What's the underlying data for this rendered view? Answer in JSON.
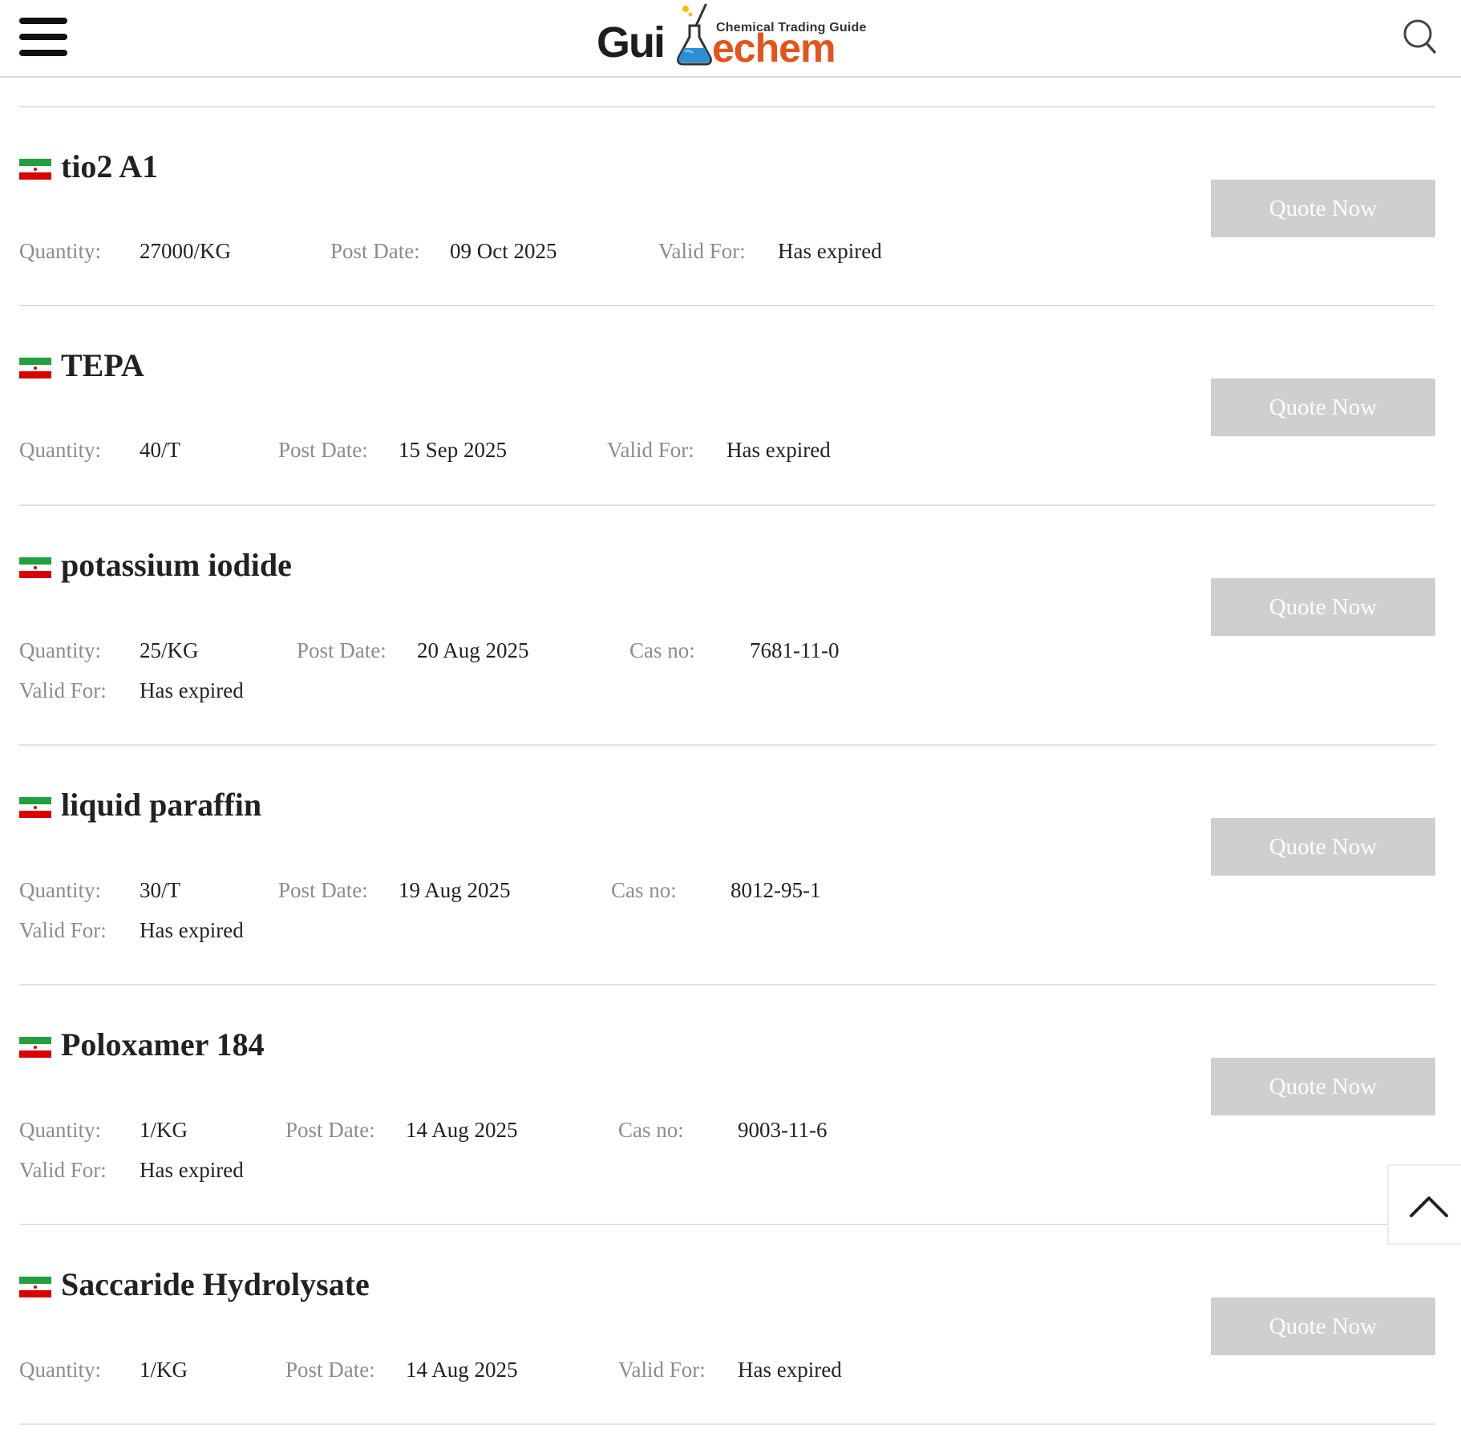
{
  "header": {
    "menu_icon": "hamburger-menu-icon",
    "search_icon": "search-icon",
    "logo": {
      "tagline": "Chemical Trading Guide",
      "word_left": "Gui",
      "word_right": "echem",
      "brand_color": "#e5531b"
    }
  },
  "labels": {
    "quantity": "Quantity:",
    "post_date": "Post Date:",
    "valid_for": "Valid For:",
    "cas_no": "Cas no:"
  },
  "quote_label": "Quote Now",
  "colors": {
    "quote_button_bg": "#cfcfcf",
    "label_text": "#8c8c8c",
    "divider": "#e2e2e2"
  },
  "items": [
    {
      "title": "tio2 A1",
      "flag": "iran-flag-icon",
      "quantity": "27000/KG",
      "post_date": "09 Oct 2025",
      "valid_for": "Has expired"
    },
    {
      "title": "TEPA",
      "flag": "iran-flag-icon",
      "quantity": "40/T",
      "post_date": "15 Sep 2025",
      "valid_for": "Has expired"
    },
    {
      "title": "potassium iodide",
      "flag": "iran-flag-icon",
      "quantity": "25/KG",
      "post_date": "20 Aug 2025",
      "cas_no": "7681-11-0",
      "valid_for": "Has expired"
    },
    {
      "title": "liquid paraffin",
      "flag": "iran-flag-icon",
      "quantity": "30/T",
      "post_date": "19 Aug 2025",
      "cas_no": "8012-95-1",
      "valid_for": "Has expired"
    },
    {
      "title": "Poloxamer 184",
      "flag": "iran-flag-icon",
      "quantity": "1/KG",
      "post_date": "14 Aug 2025",
      "cas_no": "9003-11-6",
      "valid_for": "Has expired"
    },
    {
      "title": "Saccaride Hydrolysate",
      "flag": "iran-flag-icon",
      "quantity": "1/KG",
      "post_date": "14 Aug 2025",
      "valid_for": "Has expired"
    }
  ],
  "back_to_top_icon": "chevron-up-icon"
}
